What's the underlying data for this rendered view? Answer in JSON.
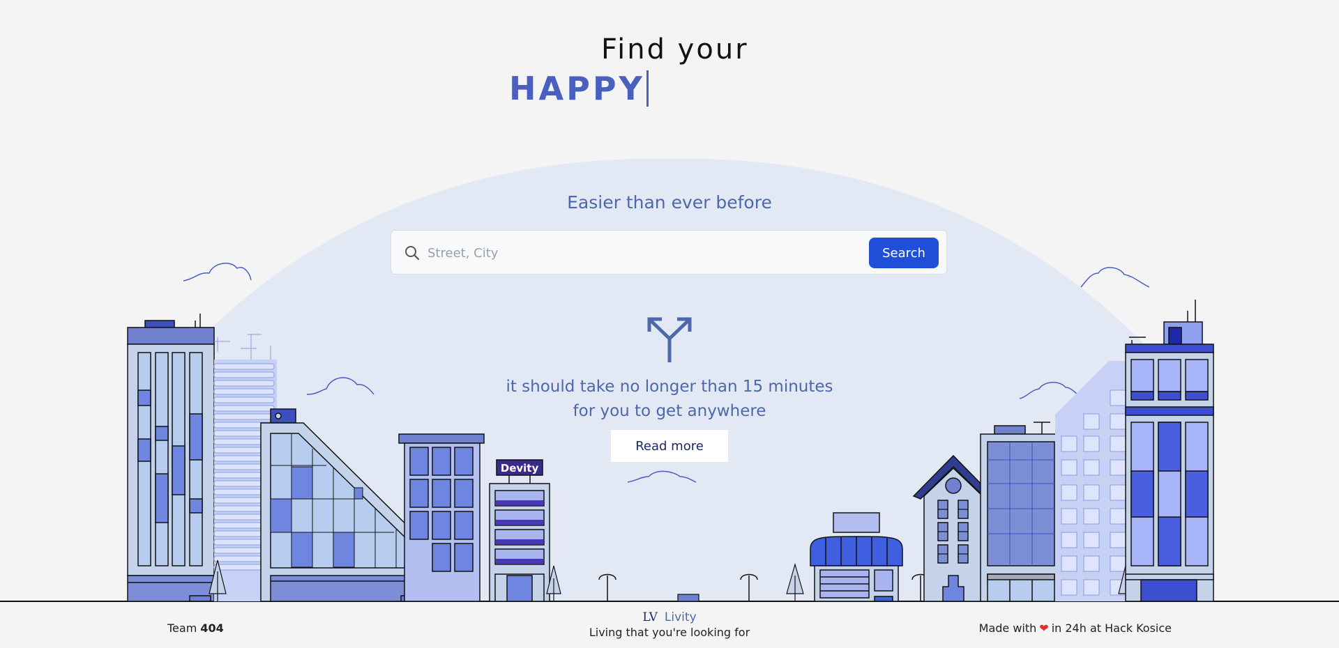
{
  "hero": {
    "line1": "Find your",
    "typed_word": "HAPPY"
  },
  "search": {
    "tagline": "Easier than ever before",
    "placeholder": "Street, City",
    "value": "",
    "button_label": "Search"
  },
  "info": {
    "line1": "it should take no longer than 15 minutes",
    "line2": "for you to get anywhere",
    "read_more_label": "Read more"
  },
  "illustration": {
    "shop_sign": "Devity"
  },
  "footer": {
    "team_prefix": "Team",
    "team_number": "404",
    "brand_logo": "LV",
    "brand_name": "Livity",
    "slogan": "Living that you're looking for",
    "made_prefix": "Made with",
    "made_suffix": "in 24h at Hack Kosice",
    "heart_icon": "heart-icon"
  },
  "colors": {
    "accent": "#4b5fbf",
    "button": "#1f4fd8",
    "dome": "#e3e8f5",
    "background": "#f4f4f4"
  }
}
